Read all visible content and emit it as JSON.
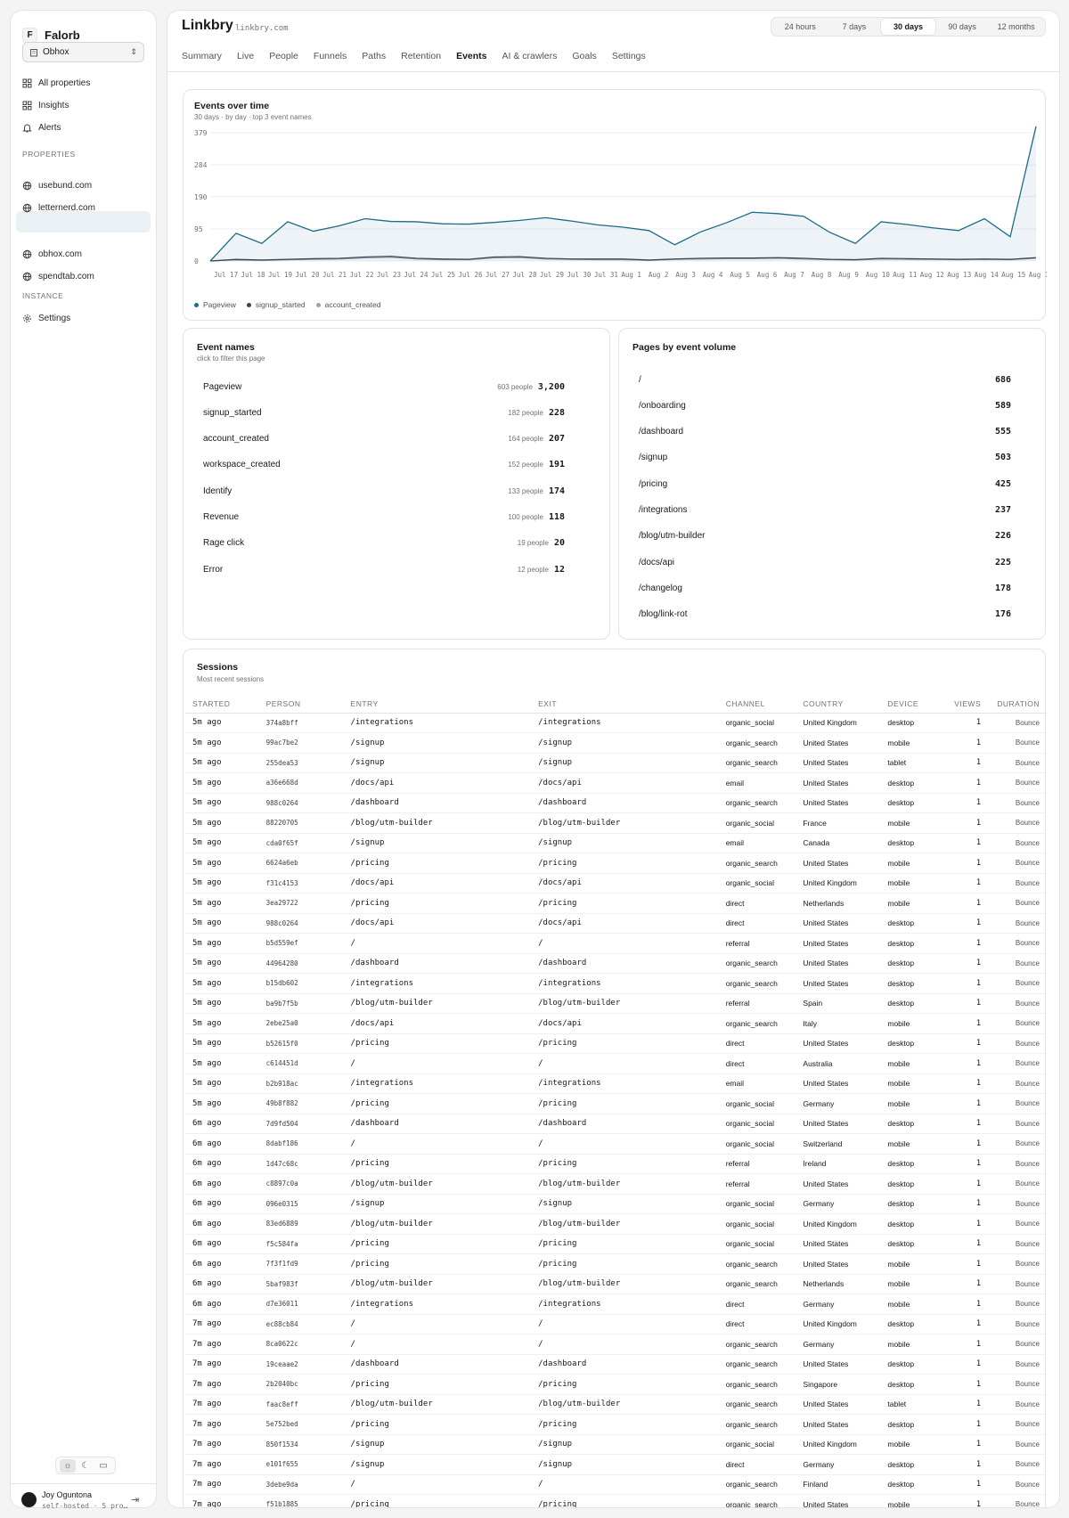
{
  "sidebar": {
    "brand_letter": "F",
    "brand_name": "Falorb",
    "org_select": "Obhox",
    "nav": [
      {
        "label": "All properties",
        "icon": "grid-icon"
      },
      {
        "label": "Insights",
        "icon": "grid-icon"
      },
      {
        "label": "Alerts",
        "icon": "bell-icon"
      }
    ],
    "properties_heading": "PROPERTIES",
    "properties": [
      "usebund.com",
      "letternerd.com",
      "",
      "obhox.com",
      "spendtab.com"
    ],
    "instance_heading": "INSTANCE",
    "settings_label": "Settings",
    "user_name": "Joy Oguntona",
    "user_sub": "self-hosted · 5 pro…"
  },
  "header": {
    "title": "Linkbry",
    "domain": "linkbry.com",
    "ranges": [
      "24 hours",
      "7 days",
      "30 days",
      "90 days",
      "12 months"
    ],
    "active_range": "30 days",
    "tabs": [
      "Summary",
      "Live",
      "People",
      "Funnels",
      "Paths",
      "Retention",
      "Events",
      "AI & crawlers",
      "Goals",
      "Settings"
    ],
    "active_tab": "Events"
  },
  "events_chart": {
    "title": "Events over time",
    "subtitle": "30 days · by day · top 3 event names"
  },
  "chart_data": {
    "type": "line",
    "yticks": [
      0,
      95,
      190,
      284,
      379
    ],
    "ylim": [
      0,
      379
    ],
    "categories": [
      "Jul 17",
      "Jul 18",
      "Jul 19",
      "Jul 20",
      "Jul 21",
      "Jul 22",
      "Jul 23",
      "Jul 24",
      "Jul 25",
      "Jul 26",
      "Jul 27",
      "Jul 28",
      "Jul 29",
      "Jul 30",
      "Jul 31",
      "Aug 1",
      "Aug 2",
      "Aug 3",
      "Aug 4",
      "Aug 5",
      "Aug 6",
      "Aug 7",
      "Aug 8",
      "Aug 9",
      "Aug 10",
      "Aug 11",
      "Aug 12",
      "Aug 13",
      "Aug 14",
      "Aug 15",
      "Aug 16"
    ],
    "xtick_labels": [
      "Jul 17",
      "Jul 18",
      "Jul 19",
      "Jul 20",
      "Jul 21",
      "Jul 22",
      "Jul 23",
      "Jul 24",
      "Jul 25",
      "Jul 26",
      "Jul 27",
      "Jul 28",
      "Jul 29",
      "Jul 30",
      "Jul 31",
      "Aug 1",
      "Aug 2",
      "Aug 3",
      "Aug 4",
      "Aug 5",
      "Aug 6",
      "Aug 7",
      "Aug 8",
      "Aug 9",
      "Aug 10",
      "Aug 11",
      "Aug 12",
      "Aug 13",
      "Aug 14",
      "Aug 15",
      "Aug 16"
    ],
    "series": [
      {
        "name": "Pageview",
        "color": "#1e6b86",
        "fill": true,
        "values": [
          0,
          82,
          52,
          116,
          88,
          104,
          125,
          117,
          116,
          110,
          109,
          114,
          120,
          128,
          118,
          107,
          100,
          90,
          48,
          86,
          113,
          144,
          140,
          132,
          85,
          52,
          116,
          108,
          98,
          90,
          125,
          72,
          398
        ]
      },
      {
        "name": "signup_started",
        "color": "#3f3f46",
        "fill": false,
        "values": [
          0,
          5,
          3,
          5,
          7,
          8,
          12,
          14,
          8,
          6,
          5,
          12,
          13,
          8,
          6,
          6,
          6,
          3,
          6,
          8,
          9,
          9,
          10,
          8,
          5,
          4,
          8,
          7,
          6,
          5,
          6,
          5,
          10
        ]
      },
      {
        "name": "account_created",
        "color": "#9ca3af",
        "fill": false,
        "values": [
          0,
          3,
          2,
          4,
          5,
          6,
          9,
          11,
          6,
          4,
          4,
          9,
          10,
          6,
          5,
          4,
          4,
          2,
          5,
          6,
          7,
          7,
          8,
          6,
          4,
          3,
          6,
          5,
          5,
          4,
          5,
          4,
          8
        ]
      }
    ],
    "grid": true,
    "legend": "bottom-left"
  },
  "event_names": {
    "title": "Event names",
    "subtitle": "click to filter this page",
    "rows": [
      {
        "name": "Pageview",
        "people": "603 people",
        "count": "3,200"
      },
      {
        "name": "signup_started",
        "people": "182 people",
        "count": "228"
      },
      {
        "name": "account_created",
        "people": "164 people",
        "count": "207"
      },
      {
        "name": "workspace_created",
        "people": "152 people",
        "count": "191"
      },
      {
        "name": "Identify",
        "people": "133 people",
        "count": "174"
      },
      {
        "name": "Revenue",
        "people": "100 people",
        "count": "118"
      },
      {
        "name": "Rage click",
        "people": "19 people",
        "count": "20"
      },
      {
        "name": "Error",
        "people": "12 people",
        "count": "12"
      }
    ]
  },
  "pages": {
    "title": "Pages by event volume",
    "rows": [
      {
        "path": "/",
        "count": "686"
      },
      {
        "path": "/onboarding",
        "count": "589"
      },
      {
        "path": "/dashboard",
        "count": "555"
      },
      {
        "path": "/signup",
        "count": "503"
      },
      {
        "path": "/pricing",
        "count": "425"
      },
      {
        "path": "/integrations",
        "count": "237"
      },
      {
        "path": "/blog/utm-builder",
        "count": "226"
      },
      {
        "path": "/docs/api",
        "count": "225"
      },
      {
        "path": "/changelog",
        "count": "178"
      },
      {
        "path": "/blog/link-rot",
        "count": "176"
      }
    ]
  },
  "sessions": {
    "title": "Sessions",
    "subtitle": "Most recent sessions",
    "columns": [
      "STARTED",
      "PERSON",
      "ENTRY",
      "EXIT",
      "CHANNEL",
      "COUNTRY",
      "DEVICE",
      "VIEWS",
      "DURATION"
    ],
    "rows": [
      [
        "5m ago",
        "374a8bff",
        "/integrations",
        "/integrations",
        "organic_social",
        "United Kingdom",
        "desktop",
        "1",
        "Bounce"
      ],
      [
        "5m ago",
        "99ac7be2",
        "/signup",
        "/signup",
        "organic_search",
        "United States",
        "mobile",
        "1",
        "Bounce"
      ],
      [
        "5m ago",
        "255dea53",
        "/signup",
        "/signup",
        "organic_search",
        "United States",
        "tablet",
        "1",
        "Bounce"
      ],
      [
        "5m ago",
        "a36e668d",
        "/docs/api",
        "/docs/api",
        "email",
        "United States",
        "desktop",
        "1",
        "Bounce"
      ],
      [
        "5m ago",
        "988c0264",
        "/dashboard",
        "/dashboard",
        "organic_search",
        "United States",
        "desktop",
        "1",
        "Bounce"
      ],
      [
        "5m ago",
        "88220705",
        "/blog/utm-builder",
        "/blog/utm-builder",
        "organic_social",
        "France",
        "mobile",
        "1",
        "Bounce"
      ],
      [
        "5m ago",
        "cda0f65f",
        "/signup",
        "/signup",
        "email",
        "Canada",
        "desktop",
        "1",
        "Bounce"
      ],
      [
        "5m ago",
        "6624a6eb",
        "/pricing",
        "/pricing",
        "organic_search",
        "United States",
        "mobile",
        "1",
        "Bounce"
      ],
      [
        "5m ago",
        "f31c4153",
        "/docs/api",
        "/docs/api",
        "organic_social",
        "United Kingdom",
        "mobile",
        "1",
        "Bounce"
      ],
      [
        "5m ago",
        "3ea29722",
        "/pricing",
        "/pricing",
        "direct",
        "Netherlands",
        "mobile",
        "1",
        "Bounce"
      ],
      [
        "5m ago",
        "988c0264",
        "/docs/api",
        "/docs/api",
        "direct",
        "United States",
        "desktop",
        "1",
        "Bounce"
      ],
      [
        "5m ago",
        "b5d559ef",
        "/",
        "/",
        "referral",
        "United States",
        "desktop",
        "1",
        "Bounce"
      ],
      [
        "5m ago",
        "44964280",
        "/dashboard",
        "/dashboard",
        "organic_search",
        "United States",
        "desktop",
        "1",
        "Bounce"
      ],
      [
        "5m ago",
        "b15db602",
        "/integrations",
        "/integrations",
        "organic_search",
        "United States",
        "desktop",
        "1",
        "Bounce"
      ],
      [
        "5m ago",
        "ba9b7f5b",
        "/blog/utm-builder",
        "/blog/utm-builder",
        "referral",
        "Spain",
        "desktop",
        "1",
        "Bounce"
      ],
      [
        "5m ago",
        "2ebe25a0",
        "/docs/api",
        "/docs/api",
        "organic_search",
        "Italy",
        "mobile",
        "1",
        "Bounce"
      ],
      [
        "5m ago",
        "b52615f0",
        "/pricing",
        "/pricing",
        "direct",
        "United States",
        "desktop",
        "1",
        "Bounce"
      ],
      [
        "5m ago",
        "c614451d",
        "/",
        "/",
        "direct",
        "Australia",
        "mobile",
        "1",
        "Bounce"
      ],
      [
        "5m ago",
        "b2b918ac",
        "/integrations",
        "/integrations",
        "email",
        "United States",
        "mobile",
        "1",
        "Bounce"
      ],
      [
        "5m ago",
        "49b8f882",
        "/pricing",
        "/pricing",
        "organic_social",
        "Germany",
        "mobile",
        "1",
        "Bounce"
      ],
      [
        "6m ago",
        "7d9fd504",
        "/dashboard",
        "/dashboard",
        "organic_social",
        "United States",
        "desktop",
        "1",
        "Bounce"
      ],
      [
        "6m ago",
        "8dabf186",
        "/",
        "/",
        "organic_social",
        "Switzerland",
        "mobile",
        "1",
        "Bounce"
      ],
      [
        "6m ago",
        "1d47c68c",
        "/pricing",
        "/pricing",
        "referral",
        "Ireland",
        "desktop",
        "1",
        "Bounce"
      ],
      [
        "6m ago",
        "c8897c0a",
        "/blog/utm-builder",
        "/blog/utm-builder",
        "referral",
        "United States",
        "desktop",
        "1",
        "Bounce"
      ],
      [
        "6m ago",
        "096e0315",
        "/signup",
        "/signup",
        "organic_social",
        "Germany",
        "desktop",
        "1",
        "Bounce"
      ],
      [
        "6m ago",
        "83ed6889",
        "/blog/utm-builder",
        "/blog/utm-builder",
        "organic_social",
        "United Kingdom",
        "desktop",
        "1",
        "Bounce"
      ],
      [
        "6m ago",
        "f5c584fa",
        "/pricing",
        "/pricing",
        "organic_social",
        "United States",
        "desktop",
        "1",
        "Bounce"
      ],
      [
        "6m ago",
        "7f3f1fd9",
        "/pricing",
        "/pricing",
        "organic_search",
        "United States",
        "mobile",
        "1",
        "Bounce"
      ],
      [
        "6m ago",
        "5baf983f",
        "/blog/utm-builder",
        "/blog/utm-builder",
        "organic_search",
        "Netherlands",
        "mobile",
        "1",
        "Bounce"
      ],
      [
        "6m ago",
        "d7e36011",
        "/integrations",
        "/integrations",
        "direct",
        "Germany",
        "mobile",
        "1",
        "Bounce"
      ],
      [
        "7m ago",
        "ec88cb84",
        "/",
        "/",
        "direct",
        "United Kingdom",
        "desktop",
        "1",
        "Bounce"
      ],
      [
        "7m ago",
        "8ca0622c",
        "/",
        "/",
        "organic_search",
        "Germany",
        "mobile",
        "1",
        "Bounce"
      ],
      [
        "7m ago",
        "19ceaae2",
        "/dashboard",
        "/dashboard",
        "organic_search",
        "United States",
        "desktop",
        "1",
        "Bounce"
      ],
      [
        "7m ago",
        "2b2040bc",
        "/pricing",
        "/pricing",
        "organic_search",
        "Singapore",
        "desktop",
        "1",
        "Bounce"
      ],
      [
        "7m ago",
        "faac8eff",
        "/blog/utm-builder",
        "/blog/utm-builder",
        "organic_search",
        "United States",
        "tablet",
        "1",
        "Bounce"
      ],
      [
        "7m ago",
        "5e752bed",
        "/pricing",
        "/pricing",
        "organic_search",
        "United States",
        "desktop",
        "1",
        "Bounce"
      ],
      [
        "7m ago",
        "850f1534",
        "/signup",
        "/signup",
        "organic_social",
        "United Kingdom",
        "mobile",
        "1",
        "Bounce"
      ],
      [
        "7m ago",
        "e101f655",
        "/signup",
        "/signup",
        "direct",
        "Germany",
        "desktop",
        "1",
        "Bounce"
      ],
      [
        "7m ago",
        "3debe9da",
        "/",
        "/",
        "organic_search",
        "Finland",
        "desktop",
        "1",
        "Bounce"
      ],
      [
        "7m ago",
        "f51b1885",
        "/pricing",
        "/pricing",
        "organic_search",
        "United States",
        "mobile",
        "1",
        "Bounce"
      ]
    ]
  }
}
